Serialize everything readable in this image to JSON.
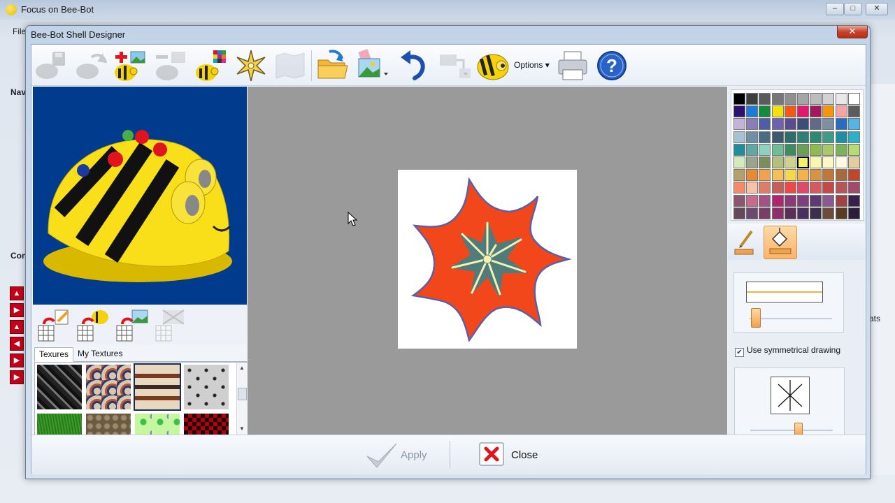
{
  "parent_window": {
    "title": "Focus on Bee-Bot",
    "menu_file": "File",
    "nav_label": "Nav",
    "con_label": "Con",
    "ats_label": "ats",
    "controls": [
      "–",
      "□",
      "✕"
    ]
  },
  "dialog": {
    "title": "Bee-Bot Shell Designer",
    "close_glyph": "✕"
  },
  "toolbar": {
    "options_label": "Options"
  },
  "texture_tabs": {
    "tab1": "Texures",
    "tab2": "My Textures"
  },
  "palette": {
    "colors": [
      [
        "#000000",
        "#3d3d3d",
        "#5b5b5b",
        "#777777",
        "#8f8f8f",
        "#a5a5a5",
        "#bcbcbc",
        "#d2d2d2",
        "#e8e8e8",
        "#ffffff"
      ],
      [
        "#2c1173",
        "#1e7ad6",
        "#138a3c",
        "#f4e10b",
        "#f05a16",
        "#e0196d",
        "#a5175d",
        "#f7940b",
        "#f5a3a3",
        "#5c5c5c"
      ],
      [
        "#c3b3d9",
        "#8a7db8",
        "#4e5da8",
        "#7060b0",
        "#5a4c8f",
        "#3e4c7a",
        "#5f6a88",
        "#7c8fa4",
        "#286bbf",
        "#53b4e6"
      ],
      [
        "#a7c2d4",
        "#6f8fa6",
        "#4b6d84",
        "#3c5a6e",
        "#2e6d6a",
        "#2f7f78",
        "#2c8a73",
        "#3f9b88",
        "#1d8fa0",
        "#2bb0c8"
      ],
      [
        "#1e8e9a",
        "#5ea9a6",
        "#8ed1c2",
        "#6ebd98",
        "#3f8a63",
        "#6a9f56",
        "#8ebb4f",
        "#a8c86a",
        "#7ab35a",
        "#b5dc72"
      ],
      [
        "#d4eabc",
        "#9aa38c",
        "#7a8f5a",
        "#b3c07c",
        "#cfd18f",
        "#f5f06a",
        "#f9f6b0",
        "#fff6c6",
        "#fffbe2",
        "#e0cf9c"
      ],
      [
        "#b3a06b",
        "#e88a33",
        "#f0a24d",
        "#f7bf5a",
        "#f7d84a",
        "#f4b24a",
        "#d99241",
        "#c0783a",
        "#a86a3c",
        "#c0482a"
      ],
      [
        "#f38a6a",
        "#f7c3a8",
        "#e07a6a",
        "#c65e5a",
        "#f04848",
        "#de4a6a",
        "#d45a5e",
        "#c44848",
        "#b7545a",
        "#a34a6a"
      ],
      [
        "#8e5570",
        "#c86a8e",
        "#a35288",
        "#b1246f",
        "#8a3a75",
        "#7d3f7f",
        "#5e3a72",
        "#8a5a8e",
        "#a04242",
        "#3a1f4a"
      ],
      [
        "#64485e",
        "#6a4a70",
        "#7a3d68",
        "#8e2e6a",
        "#5e2e5a",
        "#4a2e5e",
        "#3e2e4e",
        "#6e4a3a",
        "#5a3a22",
        "#2a1e3a"
      ]
    ],
    "selected": "#f5f06a"
  },
  "colors": {
    "star_outer": "#f2471b",
    "star_outline": "#5a5fa8",
    "star_inner": "#4f7c7a",
    "star_rays": "#f3f0b4",
    "canvas_bg": "#9a9a9a",
    "preview_bg": "#003b8e"
  },
  "symmetry": {
    "label": "Use symmetrical drawing",
    "checked": true
  },
  "footer": {
    "apply_label": "Apply",
    "close_label": "Close"
  },
  "icons": [
    "hand-cursor-icon",
    "save-icon",
    "refresh-icon",
    "add-image-icon",
    "remove-image-icon",
    "palette-icon",
    "symmetry-star-icon",
    "map-icon",
    "open-folder-icon",
    "image-import-icon",
    "undo-icon",
    "export-icon",
    "beebot-options-icon",
    "printer-icon",
    "help-icon",
    "pencil-icon",
    "fill-bucket-icon",
    "apply-check-icon",
    "close-x-icon"
  ]
}
